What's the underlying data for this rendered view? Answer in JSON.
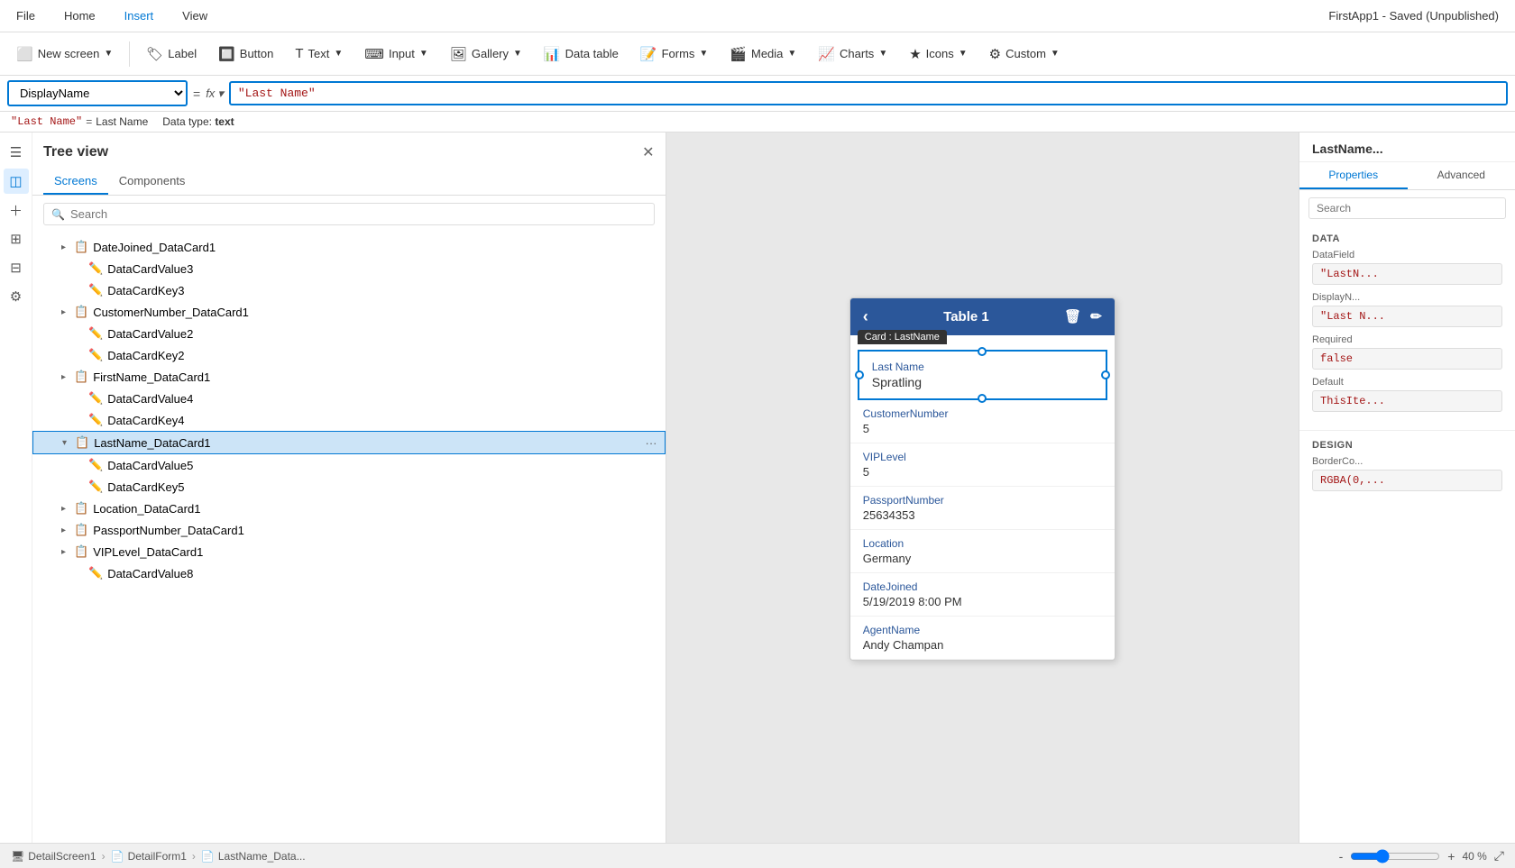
{
  "app": {
    "title": "FirstApp1 - Saved (Unpublished)"
  },
  "menu": {
    "items": [
      "File",
      "Home",
      "Insert",
      "View"
    ],
    "active": "Insert"
  },
  "toolbar": {
    "new_screen": "New screen",
    "label": "Label",
    "button": "Button",
    "text": "Text",
    "input": "Input",
    "gallery": "Gallery",
    "data_table": "Data table",
    "forms": "Forms",
    "media": "Media",
    "charts": "Charts",
    "icons": "Icons",
    "custom": "Custom"
  },
  "formula_bar": {
    "property": "DisplayName",
    "eq": "=",
    "fx": "fx",
    "value": "\"Last Name\"",
    "hint_code": "\"Last Name\"",
    "hint_eq": "=",
    "hint_plain": "Last Name",
    "data_type_label": "Data type:",
    "data_type_value": "text"
  },
  "tree_view": {
    "title": "Tree view",
    "tabs": [
      "Screens",
      "Components"
    ],
    "active_tab": "Screens",
    "search_placeholder": "Search",
    "items": [
      {
        "id": "datejoined",
        "label": "DateJoined_DataCard1",
        "indent": 1,
        "hasToggle": true,
        "expanded": false,
        "icon": "📋"
      },
      {
        "id": "datacardvalue3",
        "label": "DataCardValue3",
        "indent": 2,
        "hasToggle": false,
        "icon": "✏️"
      },
      {
        "id": "datacardkey3",
        "label": "DataCardKey3",
        "indent": 2,
        "hasToggle": false,
        "icon": "✏️"
      },
      {
        "id": "customernumber",
        "label": "CustomerNumber_DataCard1",
        "indent": 1,
        "hasToggle": true,
        "expanded": false,
        "icon": "📋"
      },
      {
        "id": "datacardvalue2",
        "label": "DataCardValue2",
        "indent": 2,
        "hasToggle": false,
        "icon": "✏️"
      },
      {
        "id": "datacardkey2",
        "label": "DataCardKey2",
        "indent": 2,
        "hasToggle": false,
        "icon": "✏️"
      },
      {
        "id": "firstname",
        "label": "FirstName_DataCard1",
        "indent": 1,
        "hasToggle": true,
        "expanded": false,
        "icon": "📋"
      },
      {
        "id": "datacardvalue4",
        "label": "DataCardValue4",
        "indent": 2,
        "hasToggle": false,
        "icon": "✏️"
      },
      {
        "id": "datacardkey4",
        "label": "DataCardKey4",
        "indent": 2,
        "hasToggle": false,
        "icon": "✏️"
      },
      {
        "id": "lastname",
        "label": "LastName_DataCard1",
        "indent": 1,
        "hasToggle": true,
        "expanded": true,
        "icon": "📋",
        "selected": true
      },
      {
        "id": "datacardvalue5",
        "label": "DataCardValue5",
        "indent": 2,
        "hasToggle": false,
        "icon": "✏️"
      },
      {
        "id": "datacardkey5",
        "label": "DataCardKey5",
        "indent": 2,
        "hasToggle": false,
        "icon": "✏️"
      },
      {
        "id": "location",
        "label": "Location_DataCard1",
        "indent": 1,
        "hasToggle": true,
        "expanded": false,
        "icon": "📋"
      },
      {
        "id": "passportnumber",
        "label": "PassportNumber_DataCard1",
        "indent": 1,
        "hasToggle": true,
        "expanded": false,
        "icon": "📋"
      },
      {
        "id": "viplevel",
        "label": "VIPLevel_DataCard1",
        "indent": 1,
        "hasToggle": true,
        "expanded": false,
        "icon": "📋"
      },
      {
        "id": "datacardvalue8",
        "label": "DataCardValue8",
        "indent": 2,
        "hasToggle": false,
        "icon": "✏️"
      }
    ]
  },
  "canvas": {
    "table_title": "Table 1",
    "card_badge": "Card : LastName",
    "fields": [
      {
        "label": "CustomerNumber",
        "value": "5"
      },
      {
        "label": "VIPLevel",
        "value": "5"
      },
      {
        "label": "PassportNumber",
        "value": "25634353"
      },
      {
        "label": "Location",
        "value": "Germany"
      },
      {
        "label": "DateJoined",
        "value": "5/19/2019 8:00 PM"
      },
      {
        "label": "AgentName",
        "value": "Andy Champan"
      }
    ],
    "selected_field_label": "Last Name",
    "selected_field_value": "Spratling"
  },
  "right_panel": {
    "title": "LastName...",
    "tabs": [
      "Properties",
      "Advanced"
    ],
    "active_tab": "Properties",
    "search_placeholder": "Search",
    "sections": {
      "data": {
        "title": "DATA",
        "fields": [
          {
            "label": "DataField",
            "value": "\"LastN..."
          },
          {
            "label": "DisplayN...",
            "value": "\"Last N..."
          },
          {
            "label": "Required",
            "value": "false"
          },
          {
            "label": "Default",
            "value": "ThisIte..."
          }
        ]
      },
      "design": {
        "title": "DESIGN",
        "fields": [
          {
            "label": "BorderCo...",
            "value": "RGBA(0,..."
          }
        ]
      }
    }
  },
  "bottom_bar": {
    "breadcrumb": [
      {
        "icon": "🖥",
        "label": "DetailScreen1"
      },
      {
        "icon": "📄",
        "label": "DetailForm1"
      },
      {
        "icon": "📄",
        "label": "LastName_Data..."
      }
    ],
    "zoom": "40 %",
    "zoom_min": "-",
    "zoom_max": "+"
  }
}
